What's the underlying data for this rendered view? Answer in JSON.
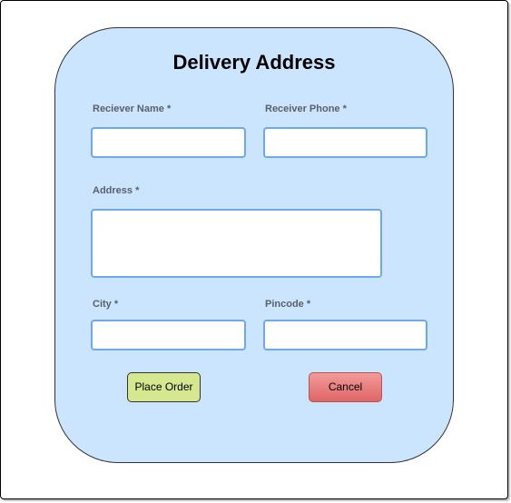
{
  "form": {
    "title": "Delivery Address",
    "receiver_name": {
      "label": "Reciever Name *",
      "value": ""
    },
    "receiver_phone": {
      "label": "Receiver Phone *",
      "value": ""
    },
    "address": {
      "label": "Address *",
      "value": ""
    },
    "city": {
      "label": "City *",
      "value": ""
    },
    "pincode": {
      "label": "Pincode *",
      "value": ""
    },
    "place_order_label": "Place Order",
    "cancel_label": "Cancel"
  },
  "colors": {
    "card_background": "#cce5ff",
    "input_border": "#6ea8f0",
    "place_order_button": "#d5e88f",
    "cancel_button": "#e06565"
  }
}
